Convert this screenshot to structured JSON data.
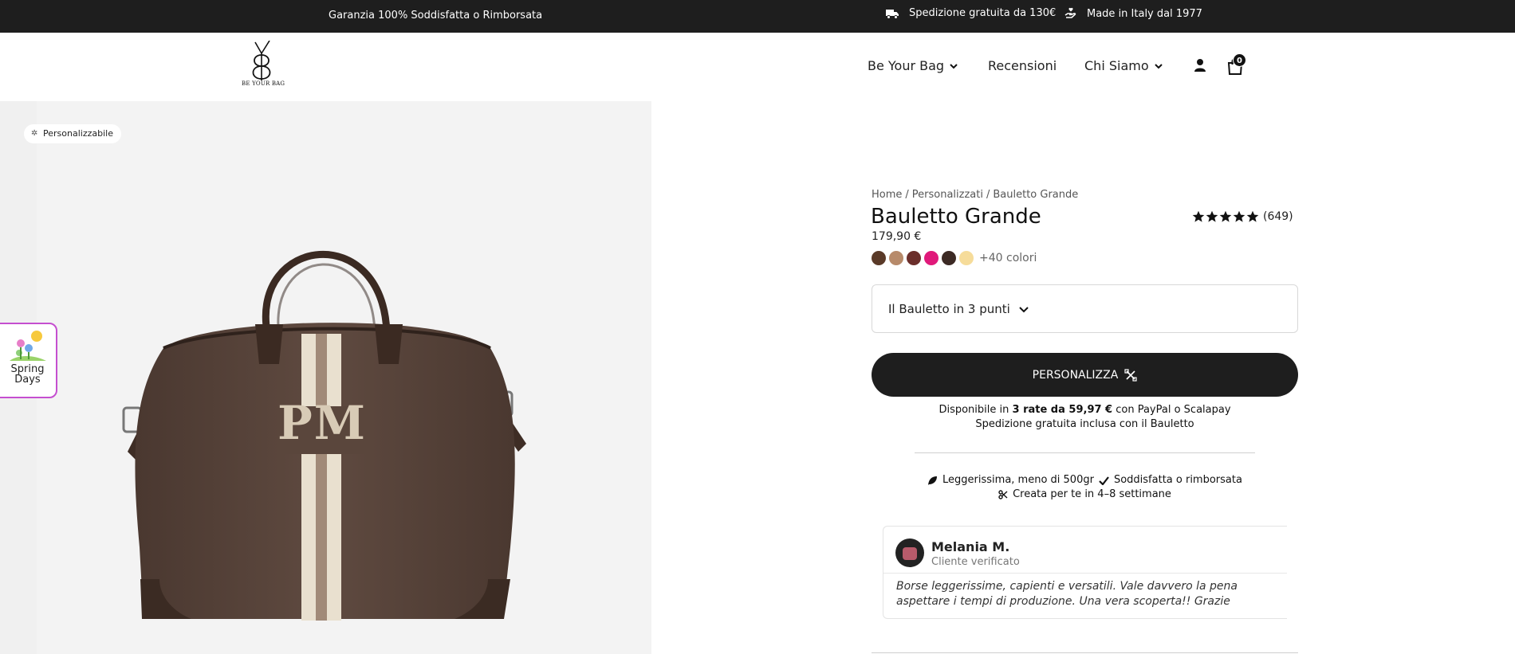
{
  "topbar": {
    "guarantee": "Garanzia 100% Soddisfatta o Rimborsata",
    "shipping": "Spedizione gratuita da 130€",
    "made_in": "Made in Italy dal 1977"
  },
  "header": {
    "logo_text": "BE YOUR BAG",
    "nav": {
      "be_your_bag": "Be Your Bag",
      "recensioni": "Recensioni",
      "chi_siamo": "Chi Siamo"
    },
    "cart_count": "0"
  },
  "gallery": {
    "badge": "Personalizzabile",
    "monogram": "PM"
  },
  "promo": {
    "line1": "Spring",
    "line2": "Days"
  },
  "product": {
    "breadcrumb": [
      "Home",
      "Personalizzati",
      "Bauletto Grande"
    ],
    "title": "Bauletto Grande",
    "rating_count": "(649)",
    "rating_stars": 5,
    "price": "179,90 €",
    "swatch_colors": [
      "#5a3a28",
      "#b78a6a",
      "#6b2e2a",
      "#e0197a",
      "#3c2a24",
      "#f6dc9a"
    ],
    "more_colors": "+40 colori",
    "select_value": "Il Bauletto in 3 punti",
    "cta": "PERSONALIZZA",
    "pay_prefix": "Disponibile in ",
    "pay_bold": "3 rate da 59,97 €",
    "pay_suffix": " con PayPal o Scalapay",
    "shipping_included": "Spedizione gratuita inclusa con il Bauletto",
    "features": {
      "light": "Leggerissima, meno di 500gr",
      "satisfied": "Soddisfatta o rimborsata",
      "made": "Creata per te in 4–8 settimane"
    }
  },
  "review": {
    "name": "Melania M.",
    "status": "Cliente verificato",
    "text": "Borse leggerissime, capienti e versatili. Vale davvero la pena aspettare i tempi di produzione. Una vera scoperta!! Grazie"
  },
  "colors": {
    "topbar_bg": "#1e1e1e",
    "cta_bg": "#1e1e1e",
    "promo_border": "#c54fd0",
    "bag_brown": "#5b463c"
  }
}
